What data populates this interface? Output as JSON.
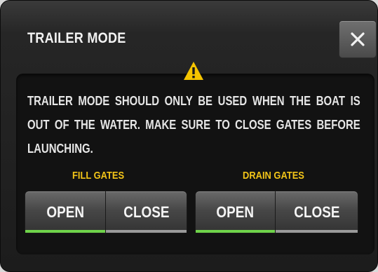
{
  "dialog": {
    "title": "TRAILER MODE",
    "close_icon": "close-icon",
    "warning_icon": "warning-triangle-icon",
    "message": "TRAILER MODE SHOULD ONLY BE USED WHEN THE BOAT IS OUT OF THE WATER. MAKE SURE TO CLOSE GATES BEFORE LAUNCHING."
  },
  "fill_gates": {
    "label": "FILL GATES",
    "open_label": "OPEN",
    "close_label": "CLOSE",
    "selected": "OPEN"
  },
  "drain_gates": {
    "label": "DRAIN GATES",
    "open_label": "OPEN",
    "close_label": "CLOSE",
    "selected": "OPEN"
  },
  "colors": {
    "accent_label": "#f2c418",
    "active_indicator": "#6fd34a",
    "inactive_indicator": "#9a9a9a",
    "warning": "#f5c400"
  }
}
